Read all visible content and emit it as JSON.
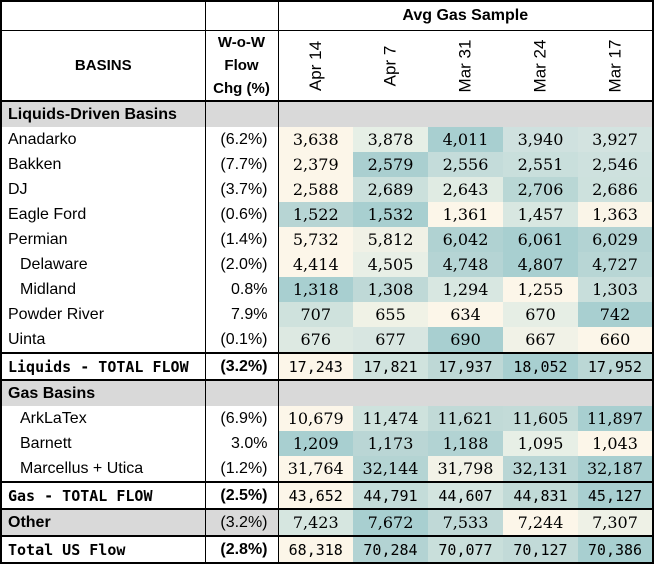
{
  "header": {
    "group_title": "Avg Gas Sample",
    "basins_label": "BASINS",
    "flow_chg_label_line1": "W-o-W",
    "flow_chg_label_line2": "Flow",
    "flow_chg_label_line3": "Chg (%)",
    "dates": [
      "Apr 14",
      "Apr 7",
      "Mar 31",
      "Mar 24",
      "Mar 17"
    ]
  },
  "rows": [
    {
      "type": "section",
      "name": "Liquids-Driven Basins"
    },
    {
      "type": "data",
      "name": "Anadarko",
      "chg": "(6.2%)",
      "values": [
        "3,638",
        "3,878",
        "4,011",
        "3,940",
        "3,927"
      ],
      "colors": [
        "#fcf6e9",
        "#e6efe6",
        "#a8cfd0",
        "#cfe1df",
        "#d3e3e0"
      ]
    },
    {
      "type": "data",
      "name": "Bakken",
      "chg": "(7.7%)",
      "values": [
        "2,379",
        "2,579",
        "2,556",
        "2,551",
        "2,546"
      ],
      "colors": [
        "#fcf6e9",
        "#aacfd0",
        "#c4dcda",
        "#c9dfdc",
        "#cee1de"
      ]
    },
    {
      "type": "data",
      "name": "DJ",
      "chg": "(3.7%)",
      "values": [
        "2,588",
        "2,689",
        "2,643",
        "2,706",
        "2,686"
      ],
      "colors": [
        "#fcf6e9",
        "#cbe0dc",
        "#e0ebe3",
        "#b9d7d5",
        "#cde1dd"
      ]
    },
    {
      "type": "data",
      "name": "Eagle Ford",
      "chg": "(0.6%)",
      "values": [
        "1,522",
        "1,532",
        "1,361",
        "1,457",
        "1,363"
      ],
      "colors": [
        "#b7d5d4",
        "#a8cfd0",
        "#fcf6e9",
        "#d8e7e1",
        "#faf5e8"
      ]
    },
    {
      "type": "data",
      "name": "Permian",
      "chg": "(1.4%)",
      "values": [
        "5,732",
        "5,812",
        "6,042",
        "6,061",
        "6,029"
      ],
      "colors": [
        "#fcf6e9",
        "#f0f1e6",
        "#b0d2d2",
        "#a8cfd0",
        "#b3d3d3"
      ]
    },
    {
      "type": "data",
      "name": "Delaware",
      "indent": true,
      "chg": "(2.0%)",
      "values": [
        "4,414",
        "4,505",
        "4,748",
        "4,807",
        "4,727"
      ],
      "colors": [
        "#fcf6e9",
        "#e8efe6",
        "#b5d4d4",
        "#a8cfd0",
        "#b8d6d5"
      ]
    },
    {
      "type": "data",
      "name": "Midland",
      "indent": true,
      "chg": "0.8%",
      "values": [
        "1,318",
        "1,308",
        "1,294",
        "1,255",
        "1,303"
      ],
      "colors": [
        "#a8cfd0",
        "#bfd9d7",
        "#d8e7e1",
        "#fcf6e9",
        "#c8dedb"
      ]
    },
    {
      "type": "data",
      "name": "Powder River",
      "chg": "7.9%",
      "values": [
        "707",
        "655",
        "634",
        "670",
        "742"
      ],
      "colors": [
        "#cfe2dd",
        "#f0f2e6",
        "#fcf6e9",
        "#e6eee5",
        "#a8cfd0"
      ]
    },
    {
      "type": "data",
      "name": "Uinta",
      "chg": "(0.1%)",
      "values": [
        "676",
        "677",
        "690",
        "667",
        "660"
      ],
      "colors": [
        "#dde9e2",
        "#d8e6e1",
        "#a8cfd0",
        "#f1f2e7",
        "#fcf6e9"
      ]
    },
    {
      "type": "total",
      "name": "Liquids - TOTAL FLOW",
      "chg": "(3.2%)",
      "values": [
        "17,243",
        "17,821",
        "17,937",
        "18,052",
        "17,952"
      ],
      "colors": [
        "#fcf6e9",
        "#d0e3de",
        "#bed8d6",
        "#a8cfd0",
        "#bbd7d5"
      ]
    },
    {
      "type": "section",
      "name": "Gas Basins"
    },
    {
      "type": "data",
      "name": "ArkLaTex",
      "indent": true,
      "chg": "(6.9%)",
      "values": [
        "10,679",
        "11,474",
        "11,621",
        "11,605",
        "11,897"
      ],
      "colors": [
        "#fcf6e9",
        "#cee2dd",
        "#c1dad7",
        "#c3dbd8",
        "#a8cfd0"
      ]
    },
    {
      "type": "data",
      "name": "Barnett",
      "indent": true,
      "chg": "3.0%",
      "values": [
        "1,209",
        "1,173",
        "1,188",
        "1,095",
        "1,043"
      ],
      "colors": [
        "#a8cfd0",
        "#bad6d5",
        "#b2d3d3",
        "#e7efe6",
        "#fcf6e9"
      ]
    },
    {
      "type": "data",
      "name": "Marcellus + Utica",
      "indent": true,
      "chg": "(1.2%)",
      "values": [
        "31,764",
        "32,144",
        "31,798",
        "32,131",
        "32,187"
      ],
      "colors": [
        "#fcf6e9",
        "#b4d4d3",
        "#f2f2e7",
        "#b9d6d5",
        "#a8cfd0"
      ]
    },
    {
      "type": "total",
      "name": "Gas - TOTAL FLOW",
      "chg": "(2.5%)",
      "values": [
        "43,652",
        "44,791",
        "44,607",
        "44,831",
        "45,127"
      ],
      "colors": [
        "#fcf6e9",
        "#c4dcd9",
        "#d3e4df",
        "#c1dad7",
        "#a8cfd0"
      ]
    },
    {
      "type": "other",
      "name": "Other",
      "chg": "(3.2%)",
      "values": [
        "7,423",
        "7,672",
        "7,533",
        "7,244",
        "7,307"
      ],
      "colors": [
        "#d6e6e0",
        "#a8cfd0",
        "#c0d9d7",
        "#fcf6e9",
        "#eef1e6"
      ]
    },
    {
      "type": "total",
      "name": "Total US Flow",
      "chg": "(2.8%)",
      "values": [
        "68,318",
        "70,284",
        "70,077",
        "70,127",
        "70,386"
      ],
      "colors": [
        "#fcf6e9",
        "#b3d3d3",
        "#c9dfdb",
        "#c2dad8",
        "#a8cfd0"
      ]
    }
  ]
}
